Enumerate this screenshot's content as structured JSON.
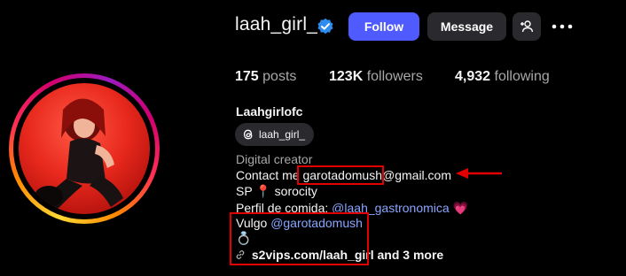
{
  "profile": {
    "username": "laah_girl_",
    "full_name": "Laahgirlofc",
    "threads_handle": "laah_girl_"
  },
  "actions": {
    "follow_label": "Follow",
    "message_label": "Message"
  },
  "stats": {
    "posts_count": "175",
    "posts_label": "posts",
    "followers_count": "123K",
    "followers_label": "followers",
    "following_count": "4,932",
    "following_label": "following"
  },
  "bio": {
    "category": "Digital creator",
    "contact_prefix": "Contact me ",
    "contact_handle": "garotadomush",
    "contact_suffix": "@gmail.com",
    "line_sp_start": "SP",
    "line_sp_pin": "📍",
    "line_sp_end": " sorocity",
    "food_prefix": "Perfil de comida: ",
    "food_handle": "@laah_gastronomica",
    "heart": "💗",
    "vulgo_prefix": "Vulgo ",
    "vulgo_handle": "@garotadomush",
    "ring": "💍",
    "link_text": "s2vips.com/laah_girl",
    "link_more": " and 3 more"
  },
  "colors": {
    "follow_button": "#4f5bff",
    "secondary_button": "#2a2a2e",
    "link": "#8aa5ff",
    "highlight": "#e30000"
  }
}
